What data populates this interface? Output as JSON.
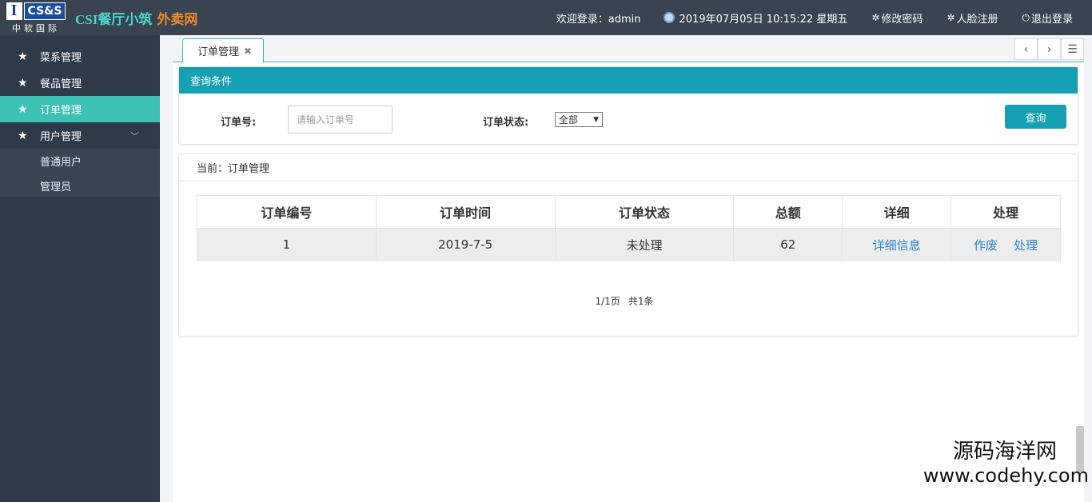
{
  "header": {
    "logo_mark": "I",
    "logo_text": "CS&S",
    "logo_sub": "中软国际",
    "brand_main": "CSI餐厅小筑",
    "brand_accent": "外卖网",
    "welcome": "欢迎登录：admin",
    "datetime": "2019年07月05日 10:15:22 星期五",
    "change_password": "修改密码",
    "face_register": "人脸注册",
    "logout": "退出登录"
  },
  "sidebar": {
    "items": [
      {
        "label": "菜系管理"
      },
      {
        "label": "餐品管理"
      },
      {
        "label": "订单管理"
      },
      {
        "label": "用户管理"
      }
    ],
    "sub_items": [
      {
        "label": "普通用户"
      },
      {
        "label": "管理员"
      }
    ]
  },
  "tabs": {
    "active": "订单管理"
  },
  "query": {
    "title": "查询条件",
    "order_no_label": "订单号:",
    "order_no_placeholder": "请输入订单号",
    "status_label": "订单状态:",
    "status_selected": "全部",
    "search_button": "查询"
  },
  "list": {
    "breadcrumb": "当前：订单管理",
    "columns": [
      "订单编号",
      "订单时间",
      "订单状态",
      "总额",
      "详细",
      "处理"
    ],
    "rows": [
      {
        "id": "1",
        "time": "2019-7-5",
        "status": "未处理",
        "total": "62",
        "detail": "详细信息",
        "void": "作废",
        "process": "处理"
      }
    ],
    "pager_pages": "1/1页",
    "pager_total": "共1条"
  },
  "watermark": {
    "line1": "源码海洋网",
    "line2": "www.codehy.com"
  },
  "colors": {
    "topbar": "#3a4350",
    "sidebar": "#2f3a48",
    "active": "#3ec1b5",
    "accent": "#16a0b3",
    "brand_main": "#4bd3c9",
    "brand_accent": "#f08a2c",
    "link": "#2b87d1"
  }
}
